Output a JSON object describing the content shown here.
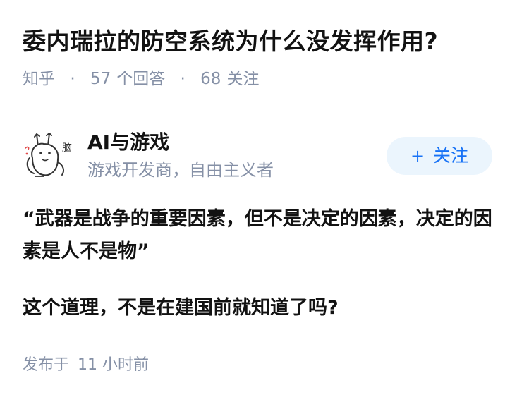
{
  "question": {
    "title": "委内瑞拉的防空系统为什么没发挥作用?",
    "source": "知乎",
    "answer_count": "57",
    "answer_label": "个回答",
    "follower_count": "68",
    "follower_label": "关注"
  },
  "author": {
    "name": "AI与游戏",
    "bio": "游戏开发商，自由主义者",
    "avatar_icon": "cartoon-rabbit-avatar-icon",
    "avatar_doodle_text": "脑",
    "follow_label": "关注",
    "follow_icon": "plus-icon"
  },
  "answer": {
    "paragraphs": [
      "“武器是战争的重要因素，但不是决定的因素，决定的因素是人不是物”",
      "这个道理，不是在建国前就知道了吗?"
    ],
    "publish_label": "发布于",
    "publish_time": "11 小时前"
  },
  "colors": {
    "text_primary": "#121212",
    "text_secondary": "#8590a6",
    "accent": "#1772f6",
    "button_bg": "#ebf5fd",
    "divider": "#ebebeb"
  }
}
